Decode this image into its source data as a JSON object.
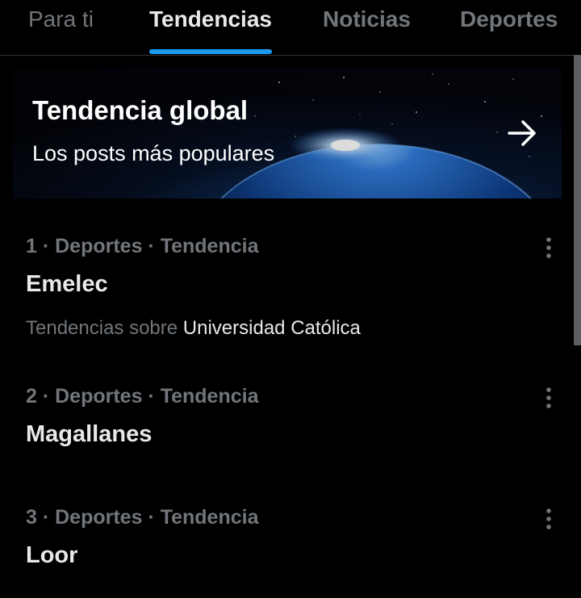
{
  "tabs": [
    {
      "label": "Para ti",
      "active": false
    },
    {
      "label": "Tendencias",
      "active": true
    },
    {
      "label": "Noticias",
      "active": false
    },
    {
      "label": "Deportes",
      "active": false
    }
  ],
  "banner": {
    "title": "Tendencia global",
    "subtitle": "Los posts más populares",
    "arrow_icon": "arrow-right-icon",
    "image": "earth-from-space-illustration"
  },
  "trends": [
    {
      "context": "1 · Deportes · Tendencia",
      "name": "Emelec",
      "sub_prefix": "Tendencias sobre",
      "sub_link": "Universidad Católica"
    },
    {
      "context": "2 · Deportes · Tendencia",
      "name": "Magallanes"
    },
    {
      "context": "3 · Deportes · Tendencia",
      "name": "Loor"
    }
  ],
  "icons": {
    "more": "more-vertical-icon"
  },
  "colors": {
    "background": "#000000",
    "text_primary": "#e7e9ea",
    "text_secondary": "#71767b",
    "accent": "#1d9bf0",
    "divider": "#2f3336"
  }
}
